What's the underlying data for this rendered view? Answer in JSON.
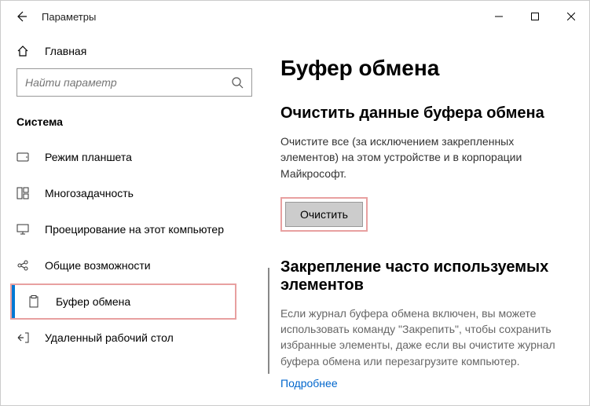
{
  "titlebar": {
    "title": "Параметры"
  },
  "sidebar": {
    "home": "Главная",
    "search_placeholder": "Найти параметр",
    "section": "Система",
    "items": [
      {
        "label": "Режим планшета"
      },
      {
        "label": "Многозадачность"
      },
      {
        "label": "Проецирование на этот компьютер"
      },
      {
        "label": "Общие возможности"
      },
      {
        "label": "Буфер обмена"
      },
      {
        "label": "Удаленный рабочий стол"
      }
    ]
  },
  "content": {
    "page_title": "Буфер обмена",
    "clear_section": {
      "heading": "Очистить данные буфера обмена",
      "desc": "Очистите все (за исключением закрепленных элементов) на этом устройстве и в корпорации Майкрософт.",
      "button": "Очистить"
    },
    "pin_section": {
      "heading": "Закрепление часто используемых элементов",
      "desc": "Если журнал буфера обмена включен, вы можете использовать команду \"Закрепить\", чтобы сохранить избранные элементы, даже если вы очистите журнал буфера обмена или перезагрузите компьютер.",
      "link": "Подробнее"
    }
  }
}
